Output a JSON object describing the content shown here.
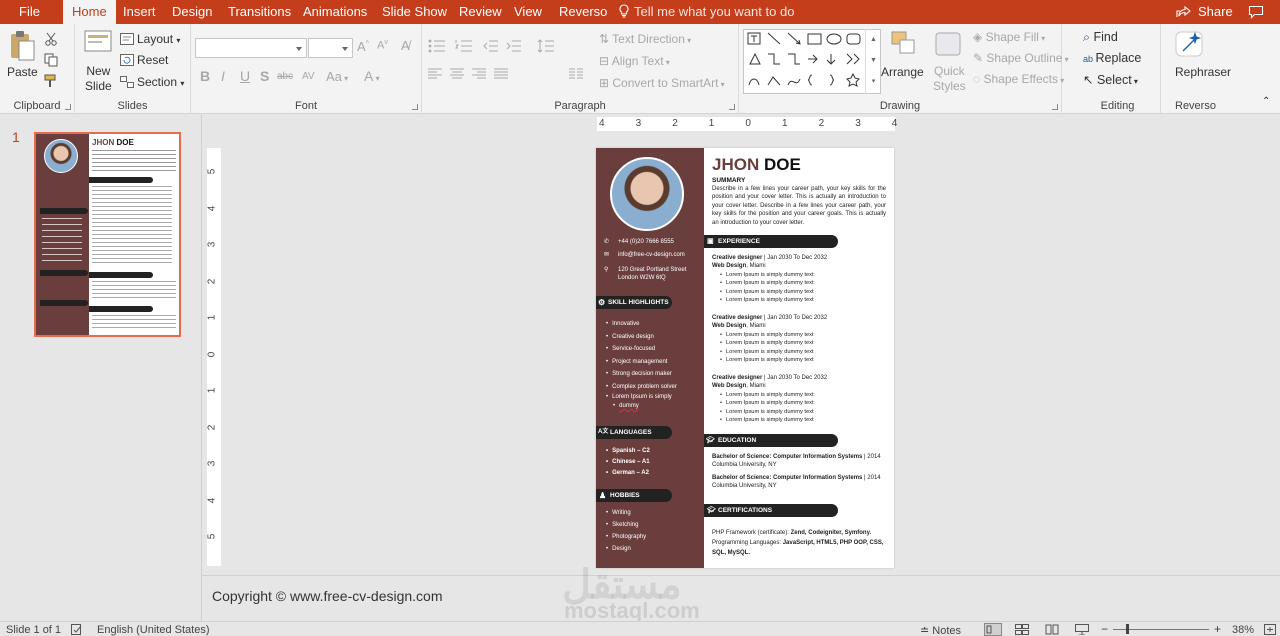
{
  "menu": {
    "tabs": [
      "File",
      "Home",
      "Insert",
      "Design",
      "Transitions",
      "Animations",
      "Slide Show",
      "Review",
      "View",
      "Reverso"
    ],
    "tell_me": "Tell me what you want to do",
    "share": "Share"
  },
  "ribbon": {
    "clipboard": {
      "paste": "Paste",
      "label": "Clipboard"
    },
    "slides": {
      "new_slide": [
        "New",
        "Slide"
      ],
      "layout": "Layout",
      "reset": "Reset",
      "section": "Section",
      "label": "Slides"
    },
    "font": {
      "label": "Font",
      "bold": "B",
      "italic": "I",
      "underline": "U",
      "shadow": "S",
      "strike": "abc",
      "spacing": "AV",
      "case": "Aa",
      "color": "A"
    },
    "paragraph": {
      "text_direction": "Text Direction",
      "align_text": "Align Text",
      "smartart": "Convert to SmartArt",
      "label": "Paragraph"
    },
    "drawing": {
      "arrange": "Arrange",
      "quick_styles": [
        "Quick",
        "Styles"
      ],
      "shape_fill": "Shape Fill",
      "shape_outline": "Shape Outline",
      "shape_effects": "Shape Effects",
      "label": "Drawing"
    },
    "editing": {
      "find": "Find",
      "replace": "Replace",
      "select": "Select",
      "label": "Editing"
    },
    "reverso": {
      "rephraser": "Rephraser",
      "label": "Reverso"
    }
  },
  "thumbnail": {
    "number": "1"
  },
  "ruler_h": [
    "4",
    "3",
    "2",
    "1",
    "0",
    "1",
    "2",
    "3",
    "4"
  ],
  "ruler_v": [
    "5",
    "4",
    "3",
    "2",
    "1",
    "0",
    "1",
    "2",
    "3",
    "4",
    "5"
  ],
  "cv": {
    "first": "JHON",
    "last": "DOE",
    "summary_title": "SUMMARY",
    "summary": "Describe in a few lines your career path, your key skills for the position and your cover letter. This is actually an introduction to your cover letter. Describe in a few lines your career path, your key skills for the position and your career goals. This is actually an introduction to your cover letter.",
    "phone": "+44 (0)20 7666 8555",
    "email": "info@free-cv-design.com",
    "address": [
      "120 Great Portland Street",
      "London W2W 6tQ"
    ],
    "skill_title": "SKILL HIGHLIGHTS",
    "skills": [
      "Innovative",
      "Creative design",
      "Service-focused",
      "Project management",
      "Strong decision maker",
      "Complex problem solver",
      "Lorem Ipsum is simply",
      "dummy"
    ],
    "languages_title": "LANGUAGES",
    "languages": [
      "Spanish – C2",
      "Chinese – A1",
      "German – A2"
    ],
    "hobbies_title": "HOBBIES",
    "hobbies": [
      "Writing",
      "Sketching",
      "Photography",
      "Design"
    ],
    "experience_title": "EXPERIENCE",
    "jobs": [
      {
        "role": "Creative designer",
        "dates": "| Jan 2030 To Dec 2032",
        "company": "Web Design",
        "place": ", Miami",
        "items": [
          "Lorem Ipsum is simply dummy text",
          "Lorem Ipsum is simply dummy text",
          "Lorem Ipsum is simply dummy text",
          "Lorem Ipsum is simply dummy text"
        ]
      },
      {
        "role": "Creative designer",
        "dates": "| Jan 2030 To Dec 2032",
        "company": "Web Design",
        "place": ", Miami",
        "items": [
          "Lorem Ipsum is simply dummy text",
          "Lorem Ipsum is simply dummy text",
          "Lorem Ipsum is simply dummy text",
          "Lorem Ipsum is simply dummy text"
        ]
      },
      {
        "role": "Creative designer",
        "dates": "| Jan 2030 To Dec 2032",
        "company": "Web Design",
        "place": ", Miami",
        "items": [
          "Lorem Ipsum is simply dummy text",
          "Lorem Ipsum is simply dummy text",
          "Lorem Ipsum is simply dummy text",
          "Lorem Ipsum is simply dummy text"
        ]
      }
    ],
    "education_title": "EDUCATION",
    "education": [
      {
        "degree": "Bachelor of Science: Computer Information Systems",
        "year": "| 2014",
        "school": "Columbia University, NY"
      },
      {
        "degree": "Bachelor of Science: Computer Information Systems",
        "year": "| 2014",
        "school": "Columbia University, NY"
      }
    ],
    "cert_title": "CERTIFICATIONS",
    "cert_line1_a": "PHP Framework (certificate): ",
    "cert_line1_b": "Zend, Codeigniter, Symfony.",
    "cert_line2_a": "Programming Languages: ",
    "cert_line2_b": "JavaScript, HTML5, PHP OOP, CSS, SQL, MySQL."
  },
  "notes_text": "Copyright © www.free-cv-design.com",
  "watermark": {
    "arabic": "مستقل",
    "latin": "mostaql.com"
  },
  "status": {
    "slide": "Slide 1 of 1",
    "language": "English (United States)",
    "notes": "Notes",
    "zoom": "38%"
  },
  "colors": {
    "accent": "#c43e1c",
    "sidebar": "#6b3e3e"
  }
}
